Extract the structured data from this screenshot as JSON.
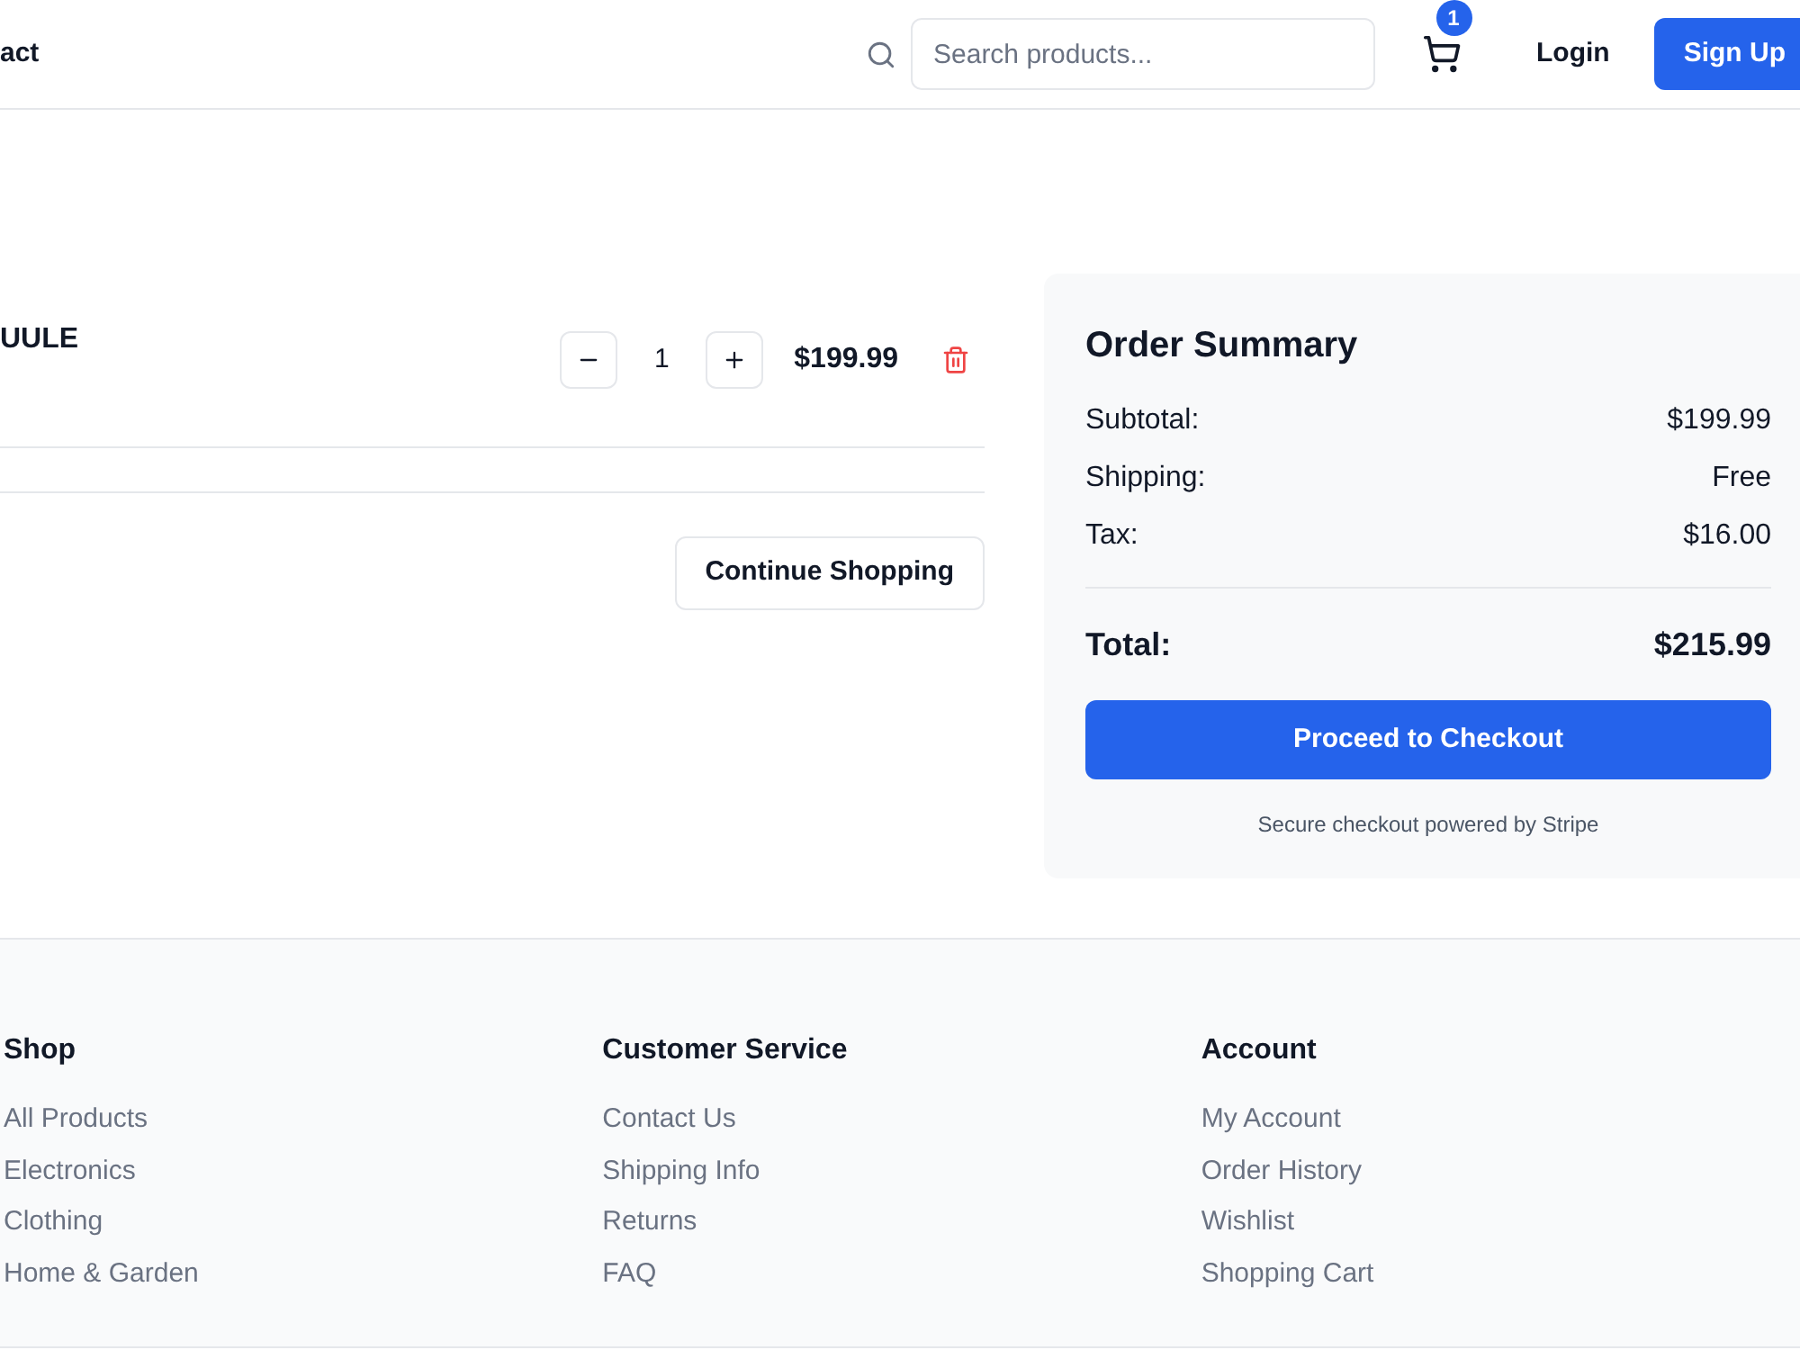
{
  "header": {
    "nav_link": "act",
    "search": {
      "placeholder": "Search products..."
    },
    "cart_count": "1",
    "login": "Login",
    "signup": "Sign Up"
  },
  "cart_items": [
    {
      "name": "UULE",
      "quantity": "1",
      "price": "$199.99"
    }
  ],
  "continue_button": "Continue Shopping",
  "order_summary": {
    "title": "Order Summary",
    "rows": [
      {
        "label": "Subtotal:",
        "value": "$199.99"
      },
      {
        "label": "Shipping:",
        "value": "Free"
      },
      {
        "label": "Tax:",
        "value": "$16.00"
      }
    ],
    "total": {
      "label": "Total:",
      "value": "$215.99"
    },
    "checkout_button": "Proceed to Checkout",
    "note": "Secure checkout powered by Stripe"
  },
  "footer": {
    "columns": [
      {
        "heading": "Shop",
        "links": [
          "All Products",
          "Electronics",
          "Clothing",
          "Home & Garden"
        ]
      },
      {
        "heading": "Customer Service",
        "links": [
          "Contact Us",
          "Shipping Info",
          "Returns",
          "FAQ"
        ]
      },
      {
        "heading": "Account",
        "links": [
          "My Account",
          "Order History",
          "Wishlist",
          "Shopping Cart"
        ]
      }
    ]
  }
}
